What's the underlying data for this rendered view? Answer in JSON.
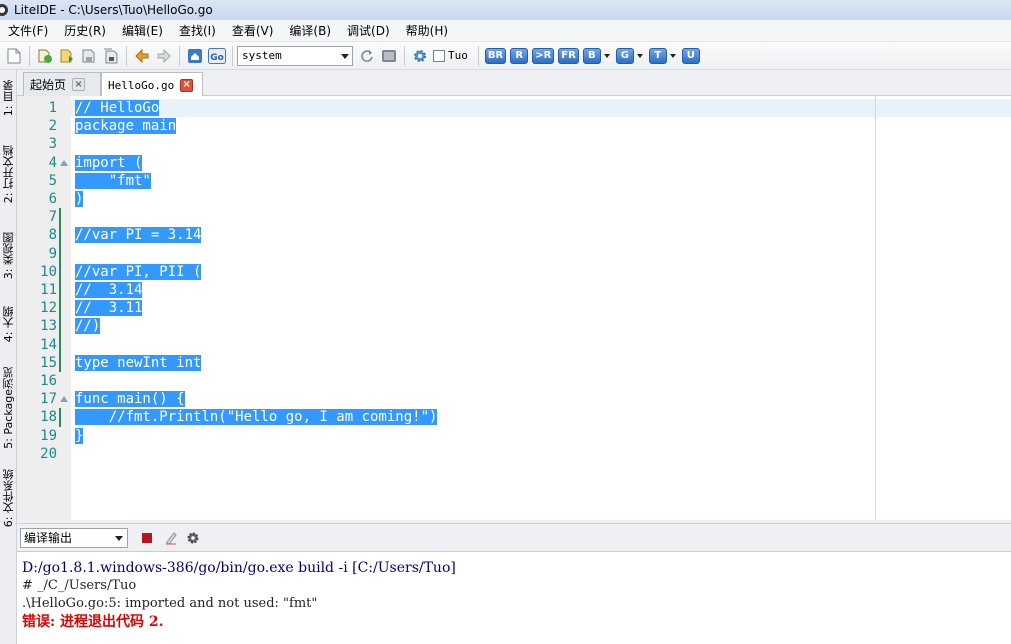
{
  "window": {
    "title": "LiteIDE - C:\\Users\\Tuo\\HelloGo.go"
  },
  "menu": [
    "文件(F)",
    "历史(R)",
    "编辑(E)",
    "查找(I)",
    "查看(V)",
    "编译(B)",
    "调试(D)",
    "帮助(H)"
  ],
  "toolbar": {
    "env_select": "system",
    "checkbox_label": "Tuo",
    "checkbox_checked": false,
    "build_buttons": [
      "BR",
      "R",
      ">R",
      "FR",
      "B",
      "G",
      "T",
      "U"
    ],
    "go_label": "Go"
  },
  "sidebar_tabs": [
    "1: 目录",
    "2: 打开文档",
    "3: 类视图",
    "4: 大纲",
    "5: Package浏览",
    "6: 文件系统"
  ],
  "tabs": [
    {
      "label": "起始页",
      "active": false
    },
    {
      "label": "HelloGo.go",
      "active": true
    }
  ],
  "editor": {
    "lines": [
      "// HelloGo",
      "package main",
      "",
      "import (",
      "    \"fmt\"",
      ")",
      "",
      "//var PI = 3.14",
      "",
      "//var PI, PII (",
      "//  3.14",
      "//  3.11",
      "//)",
      "",
      "type newInt int",
      "",
      "func main() {",
      "    //fmt.Println(\"Hello go, I am coming!\")",
      "}",
      ""
    ],
    "fold_lines": [
      4,
      17
    ],
    "line_numbers": [
      "1",
      "2",
      "3",
      "4",
      "5",
      "6",
      "7",
      "8",
      "9",
      "10",
      "11",
      "12",
      "13",
      "14",
      "15",
      "16",
      "17",
      "18",
      "19",
      "20"
    ]
  },
  "output_panel": {
    "selector": "编译输出",
    "lines": {
      "command": "D:/go1.8.1.windows-386/go/bin/go.exe build -i [C:/Users/Tuo]",
      "package": "# _/C_/Users/Tuo",
      "message": ".\\HelloGo.go:5: imported and not used: \"fmt\"",
      "error": "错误: 进程退出代码 2."
    }
  },
  "colors": {
    "selection": "#3399ff",
    "line_number": "#1e8a8a",
    "error": "#e00000",
    "command": "#000080"
  }
}
